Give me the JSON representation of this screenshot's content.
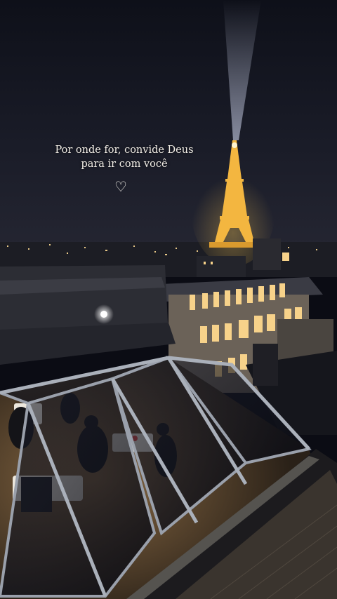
{
  "overlay": {
    "line1": "Por onde for, convide Deus",
    "line2": "para ir com você",
    "heart_icon": "♡"
  },
  "scene": {
    "subject": "night-rooftop-restaurant-eiffel-tower",
    "colors": {
      "sky": "#121420",
      "tower_light": "#f3b640",
      "window_light": "#f7d28a",
      "roof": "#2a2b33"
    }
  }
}
